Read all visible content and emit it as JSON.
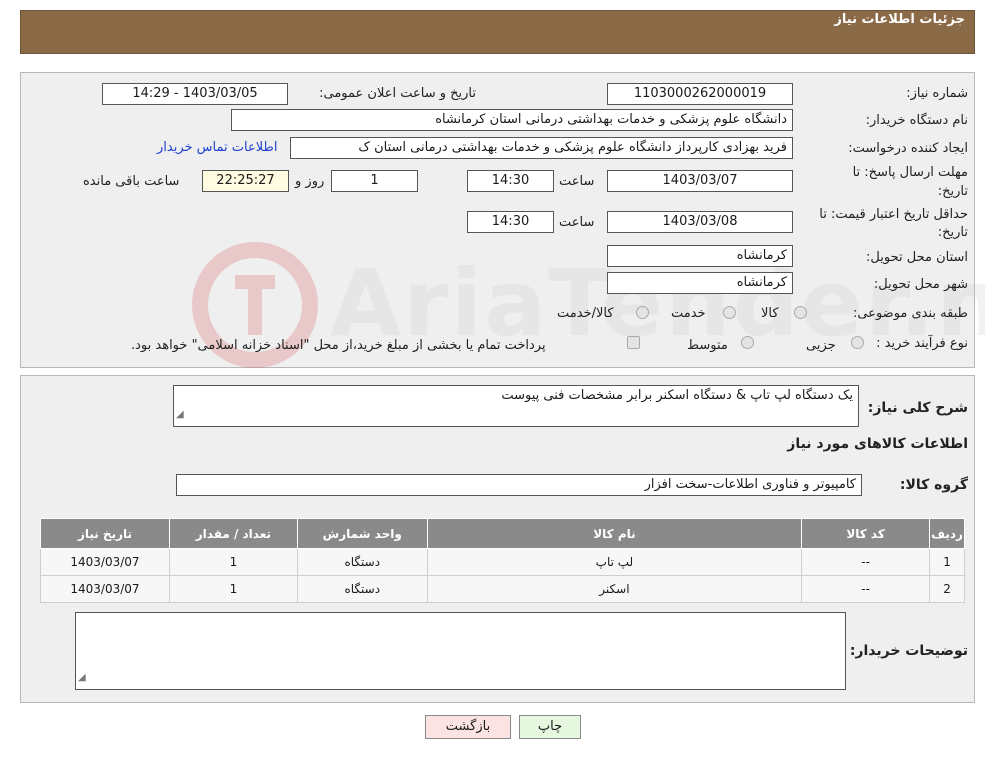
{
  "header": {
    "title": "جزئیات اطلاعات نیاز"
  },
  "fields": {
    "need_number_label": "شماره نیاز:",
    "need_number": "1103000262000019",
    "announce_label": "تاریخ و ساعت اعلان عمومی:",
    "announce_value": "1403/03/05 - 14:29",
    "buyer_label": "نام دستگاه خریدار:",
    "buyer_value": "دانشگاه علوم پزشکی و خدمات بهداشتی  درمانی استان کرمانشاه",
    "creator_label": "ایجاد کننده درخواست:",
    "creator_value": "فرید  بهزادی کارپرداز دانشگاه علوم پزشکی و خدمات بهداشتی  درمانی استان ک",
    "contact_link": "اطلاعات تماس خریدار",
    "deadline_label_1": "مهلت ارسال پاسخ: تا",
    "deadline_label_2": "تاریخ:",
    "deadline_date": "1403/03/07",
    "time_label": "ساعت",
    "deadline_time": "14:30",
    "days_value": "1",
    "days_label": "روز و",
    "remaining_value": "22:25:27",
    "remaining_label": "ساعت باقی مانده",
    "validity_label_1": "حداقل تاریخ اعتبار قیمت: تا",
    "validity_label_2": "تاریخ:",
    "validity_date": "1403/03/08",
    "validity_time": "14:30",
    "province_label": "استان محل تحویل:",
    "province_value": "کرمانشاه",
    "city_label": "شهر محل تحویل:",
    "city_value": "کرمانشاه",
    "category_label": "طبقه بندی موضوعی:",
    "category_options": [
      "کالا",
      "خدمت",
      "کالا/خدمت"
    ],
    "process_label": "نوع فرآیند خرید :",
    "process_options": [
      "جزیی",
      "متوسط"
    ],
    "process_note": "پرداخت تمام یا بخشی از مبلغ خرید،از محل \"اسناد خزانه اسلامی\" خواهد بود."
  },
  "description": {
    "label": "شرح کلی نیاز:",
    "value": "یک دستگاه لپ تاپ & دستگاه اسکنر برابر مشخصات  فنی پیوست"
  },
  "goods_section_title": "اطلاعات کالاهای مورد نیاز",
  "goods_group": {
    "label": "گروه کالا:",
    "value": "کامپیوتر و فناوری اطلاعات-سخت افزار"
  },
  "table": {
    "headers": [
      "ردیف",
      "کد کالا",
      "نام کالا",
      "واحد شمارش",
      "تعداد / مقدار",
      "تاریخ نیاز"
    ],
    "rows": [
      [
        "1",
        "--",
        "لپ تاپ",
        "دستگاه",
        "1",
        "1403/03/07"
      ],
      [
        "2",
        "--",
        "اسکنر",
        "دستگاه",
        "1",
        "1403/03/07"
      ]
    ]
  },
  "buyer_notes": {
    "label": "توضیحات خریدار:",
    "value": ""
  },
  "buttons": {
    "print": "چاپ",
    "back": "بازگشت"
  },
  "watermark": "AriaTender.neT",
  "colors": {
    "header": "#8b6b47",
    "table_header": "#8a8a8a",
    "link": "#1f3fd1",
    "back_button": "#fbe3e3",
    "print_button": "#e6f7e0"
  }
}
